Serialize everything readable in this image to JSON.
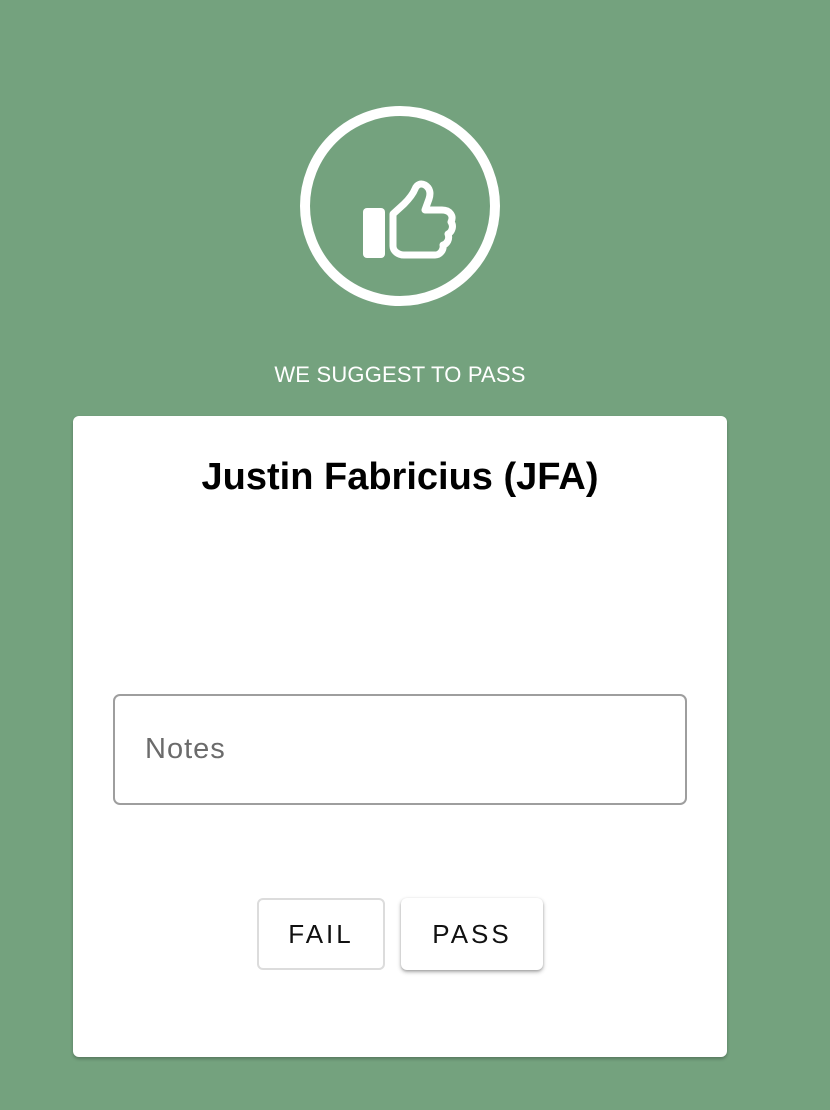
{
  "theme": {
    "background_color": "#74a27e",
    "card_color": "#ffffff"
  },
  "status_icon": "thumbs-up-icon",
  "suggestion_text": "WE SUGGEST TO PASS",
  "card": {
    "person_name": "Justin Fabricius (JFA)",
    "notes": {
      "placeholder": "Notes",
      "value": ""
    },
    "actions": {
      "fail_label": "FAIL",
      "pass_label": "PASS"
    }
  }
}
